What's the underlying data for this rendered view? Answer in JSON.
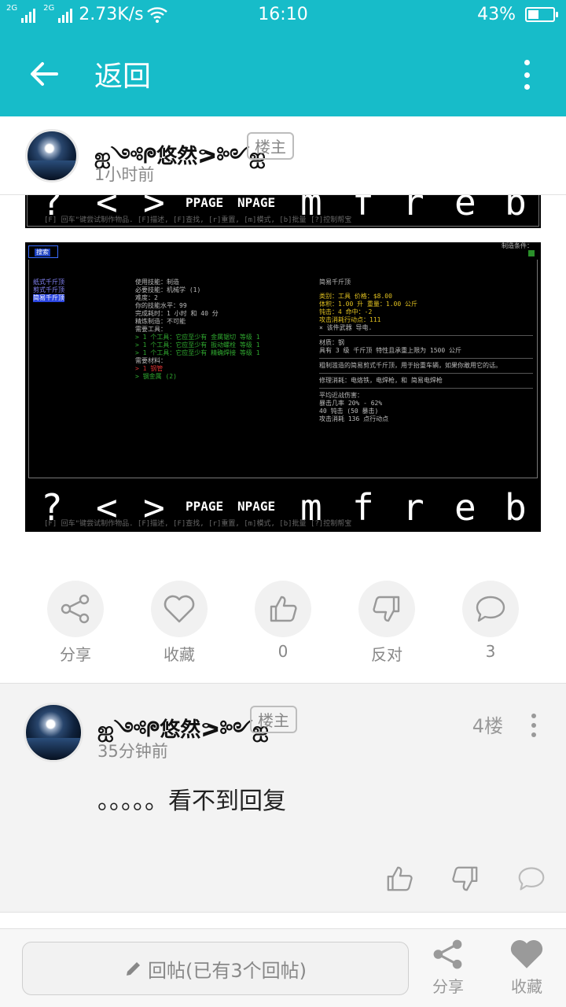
{
  "status_bar": {
    "net_tag_1": "2G",
    "net_tag_2": "2G",
    "speed": "2.73K/s",
    "time": "16:10",
    "battery": "43%",
    "battery_level": 0.43
  },
  "app_bar": {
    "title": "返回"
  },
  "post": {
    "author": "ஐ༺ᖘ悠然ᕗ༻ஐ",
    "author_badge": "楼主",
    "time": "1小时前"
  },
  "terminal": {
    "keys": [
      "?",
      "<",
      ">",
      "PPAGE",
      "NPAGE",
      "m",
      "f",
      "r",
      "e",
      "b"
    ],
    "hint": "[F] 回车\"键尝试制作物品. [F]描述, [F]查找, [r]重置, [m]模式, [b]批量 [?]控制帮宝",
    "tab_label": "搜索",
    "top_right": "制造条件：",
    "recipe_list": [
      "纸式千斤顶",
      "剪式千斤顶",
      "简易千斤顶"
    ],
    "details": [
      "使用技能：制造",
      "必要技能：机械学 (1)",
      "难度：2",
      "你的技能水平：99",
      "完成耗时：1 小时 和 40 分",
      "精炼制造：不可能",
      "需要工具：",
      "> 1 个工具：它应至少有 金属锯切 等级 1",
      "> 1 个工具：它应至少有 扳动螺栓 等级 1",
      "> 1 个工具：它应至少有 精确焊接 等级 1",
      "需要材料：",
      "> 1 钢管",
      "> 钢金属 (2)"
    ],
    "item_name": "简易千斤顶",
    "item_stats": [
      "类别：工具  价格：$8.00",
      "体积：1.00 升  重量：1.00 公斤",
      "钝击：4  命中：-2",
      "攻击消耗行动点：111",
      "× 该件武器 导电."
    ],
    "material": "材质：钢",
    "lift": "具有 3 级 千斤顶 特性且承重上限为 1500 公斤",
    "description": "粗制滥造的简易剪式千斤顶，用于抬重车辆，如果你敢用它的话。",
    "repair": "修理消耗：电烙铁，电焊枪，和 简易电焊枪",
    "combat": [
      "平均近战伤害：",
      "暴击几率 20% - 62%",
      "40 钝击 (50 暴击)",
      "攻击消耗 136 点行动点"
    ]
  },
  "actions": {
    "share": "分享",
    "favorite": "收藏",
    "likes": "0",
    "oppose": "反对",
    "comments": "3"
  },
  "reply": {
    "author": "ஐ༺ᖘ悠然ᕗ༻ஐ",
    "author_badge": "楼主",
    "floor": "4楼",
    "time": "35分钟前",
    "text": "。。。。。看不到回复"
  },
  "bottom_bar": {
    "reply_placeholder": "回帖(已有3个回帖)",
    "share": "分享",
    "favorite": "收藏"
  },
  "colors": {
    "accent": "#17bcc9",
    "terminal_bg": "#000000"
  }
}
